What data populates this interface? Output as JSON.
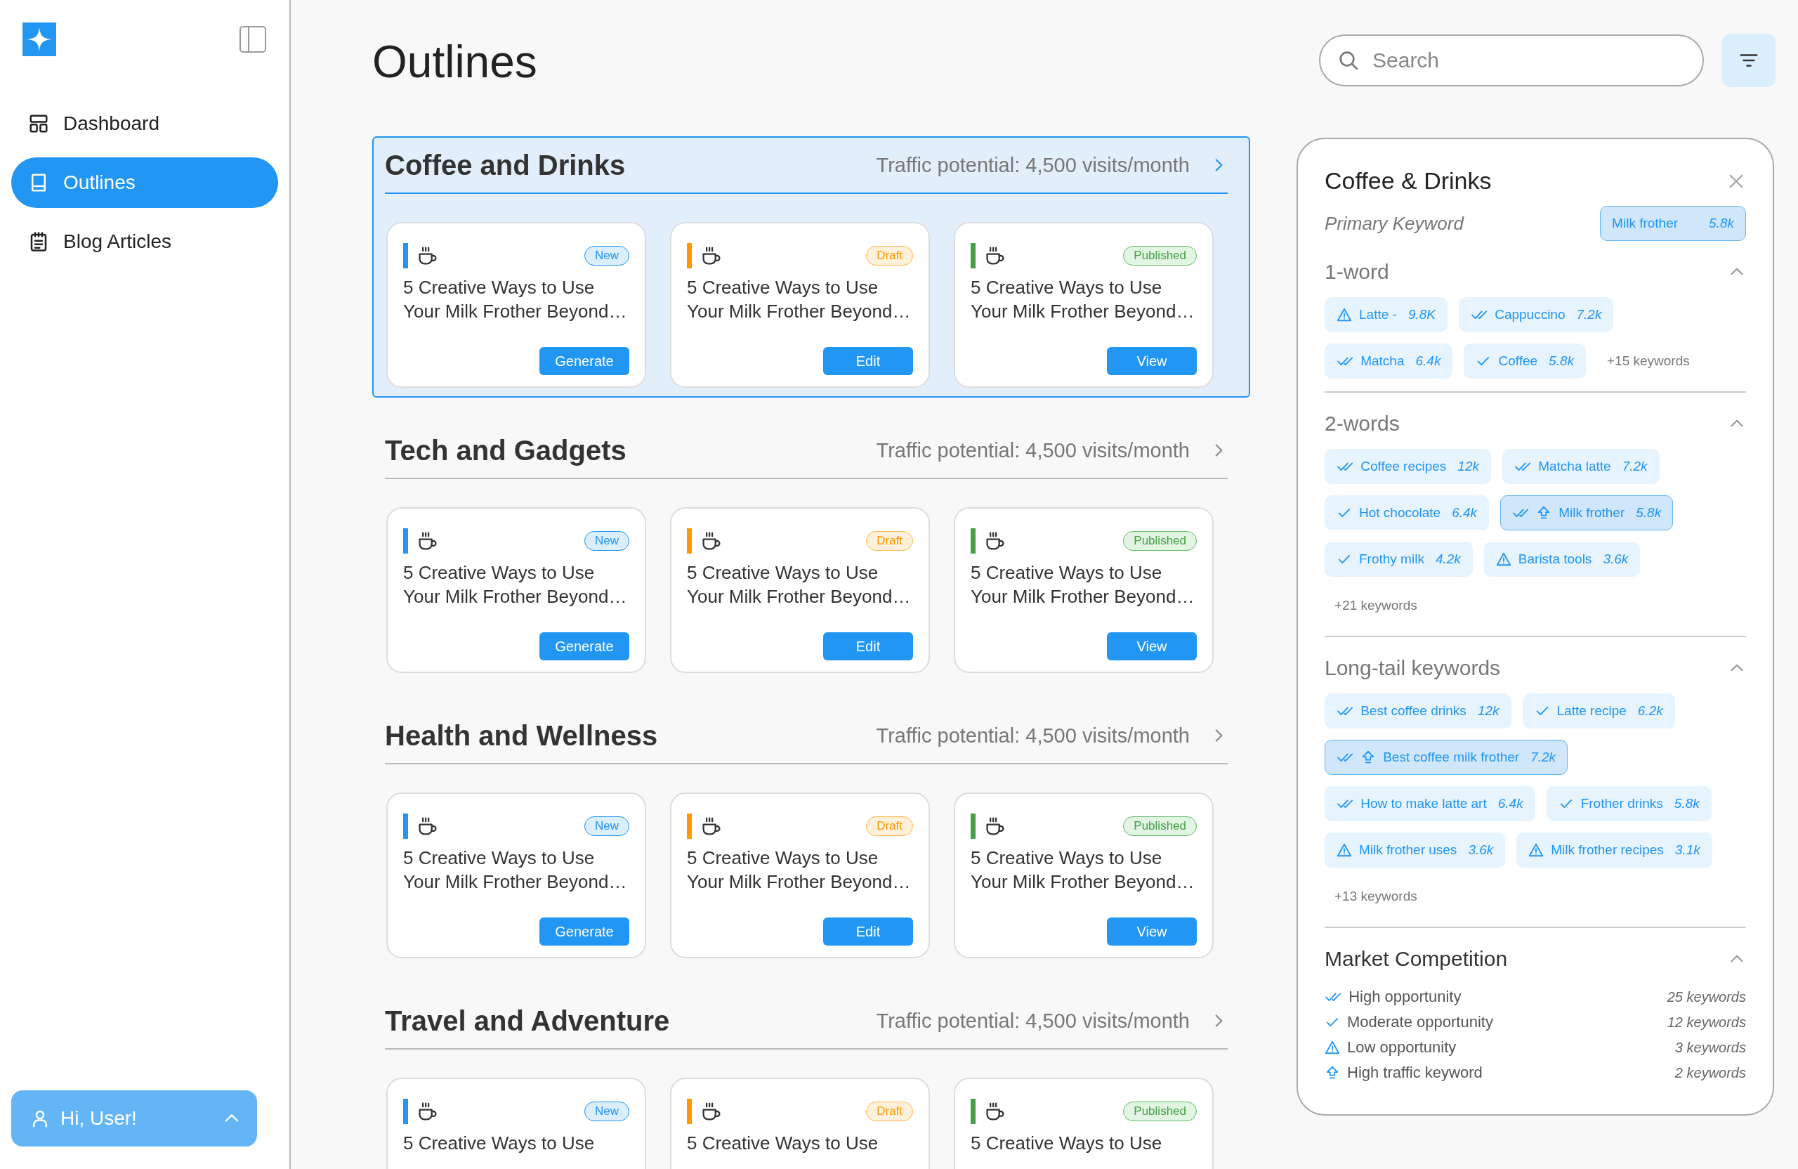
{
  "sidebar": {
    "items": [
      {
        "label": "Dashboard",
        "selected": false
      },
      {
        "label": "Outlines",
        "selected": true
      },
      {
        "label": "Blog Articles",
        "selected": false
      }
    ],
    "user_button": {
      "label": "Hi, User!"
    }
  },
  "header": {
    "title": "Outlines",
    "search": {
      "placeholder": "Search"
    }
  },
  "groups": [
    {
      "title": "Coffee and Drinks",
      "traffic": "Traffic potential: 4,500 visits/month",
      "selected": true,
      "cards": [
        {
          "kind": "new",
          "badge": "New",
          "title": "5 Creative Ways to Use Your Milk Frother Beyond…",
          "action": "Generate"
        },
        {
          "kind": "draft",
          "badge": "Draft",
          "title": "5 Creative Ways to Use Your Milk Frother Beyond…",
          "action": "Edit"
        },
        {
          "kind": "published",
          "badge": "Published",
          "title": "5 Creative Ways to Use Your Milk Frother Beyond…",
          "action": "View"
        }
      ]
    },
    {
      "title": "Tech and Gadgets",
      "traffic": "Traffic potential: 4,500 visits/month",
      "selected": false,
      "cards": [
        {
          "kind": "new",
          "badge": "New",
          "title": "5 Creative Ways to Use Your Milk Frother Beyond…",
          "action": "Generate"
        },
        {
          "kind": "draft",
          "badge": "Draft",
          "title": "5 Creative Ways to Use Your Milk Frother Beyond…",
          "action": "Edit"
        },
        {
          "kind": "published",
          "badge": "Published",
          "title": "5 Creative Ways to Use Your Milk Frother Beyond…",
          "action": "View"
        }
      ]
    },
    {
      "title": "Health and Wellness",
      "traffic": "Traffic potential: 4,500 visits/month",
      "selected": false,
      "cards": [
        {
          "kind": "new",
          "badge": "New",
          "title": "5 Creative Ways to Use Your Milk Frother Beyond…",
          "action": "Generate"
        },
        {
          "kind": "draft",
          "badge": "Draft",
          "title": "5 Creative Ways to Use Your Milk Frother Beyond…",
          "action": "Edit"
        },
        {
          "kind": "published",
          "badge": "Published",
          "title": "5 Creative Ways to Use Your Milk Frother Beyond…",
          "action": "View"
        }
      ]
    },
    {
      "title": "Travel and Adventure",
      "traffic": "Traffic potential: 4,500 visits/month",
      "selected": false,
      "cards": [
        {
          "kind": "new",
          "badge": "New",
          "title": "5 Creative Ways to Use"
        },
        {
          "kind": "draft",
          "badge": "Draft",
          "title": "5 Creative Ways to Use"
        },
        {
          "kind": "published",
          "badge": "Published",
          "title": "5 Creative Ways to Use"
        }
      ]
    }
  ],
  "panel": {
    "title": "Coffee & Drinks",
    "primary_label": "Primary Keyword",
    "primary_keyword": {
      "label": "Milk frother",
      "value": "5.8k"
    },
    "sections": [
      {
        "title": "1-word",
        "expanded": true,
        "more": "+15 keywords",
        "keywords": [
          {
            "label": "Latte -",
            "value": "9.8K",
            "kind": "warning",
            "high_traffic": false,
            "selected": false
          },
          {
            "label": "Cappuccino",
            "value": "7.2k",
            "kind": "double",
            "high_traffic": false,
            "selected": false
          },
          {
            "label": "Matcha",
            "value": "6.4k",
            "kind": "double",
            "high_traffic": false,
            "selected": false
          },
          {
            "label": "Coffee",
            "value": "5.8k",
            "kind": "check",
            "high_traffic": false,
            "selected": false
          }
        ]
      },
      {
        "title": "2-words",
        "expanded": true,
        "more": "+21 keywords",
        "keywords": [
          {
            "label": "Coffee recipes",
            "value": "12k",
            "kind": "double",
            "high_traffic": false,
            "selected": false
          },
          {
            "label": "Matcha latte",
            "value": "7.2k",
            "kind": "double",
            "high_traffic": false,
            "selected": false
          },
          {
            "label": "Hot chocolate",
            "value": "6.4k",
            "kind": "check",
            "high_traffic": false,
            "selected": false
          },
          {
            "label": "Milk frother",
            "value": "5.8k",
            "kind": "double",
            "high_traffic": true,
            "selected": true
          },
          {
            "label": "Frothy milk",
            "value": "4.2k",
            "kind": "check",
            "high_traffic": false,
            "selected": false
          },
          {
            "label": "Barista tools",
            "value": "3.6k",
            "kind": "warning",
            "high_traffic": false,
            "selected": false
          }
        ]
      },
      {
        "title": "Long-tail keywords",
        "expanded": true,
        "more": "+13 keywords",
        "keywords": [
          {
            "label": "Best coffee drinks",
            "value": "12k",
            "kind": "double",
            "high_traffic": false,
            "selected": false
          },
          {
            "label": "Latte recipe",
            "value": "6.2k",
            "kind": "check",
            "high_traffic": false,
            "selected": false
          },
          {
            "label": "Best coffee milk frother",
            "value": "7.2k",
            "kind": "double",
            "high_traffic": true,
            "selected": true
          },
          {
            "label": "How to make latte art",
            "value": "6.4k",
            "kind": "double",
            "high_traffic": false,
            "selected": false
          },
          {
            "label": "Frother drinks",
            "value": "5.8k",
            "kind": "check",
            "high_traffic": false,
            "selected": false
          },
          {
            "label": "Milk frother uses",
            "value": "3.6k",
            "kind": "warning",
            "high_traffic": false,
            "selected": false
          },
          {
            "label": "Milk frother recipes",
            "value": "3.1k",
            "kind": "warning",
            "high_traffic": false,
            "selected": false
          }
        ]
      }
    ],
    "competition": {
      "title": "Market Competition",
      "expanded": true,
      "rows": [
        {
          "kind": "double",
          "label": "High opportunity",
          "count": "25 keywords"
        },
        {
          "kind": "check",
          "label": "Moderate opportunity",
          "count": "12 keywords"
        },
        {
          "kind": "warning",
          "label": "Low opportunity",
          "count": "3 keywords"
        },
        {
          "kind": "traffic",
          "label": "High traffic keyword",
          "count": "2 keywords"
        }
      ]
    }
  }
}
